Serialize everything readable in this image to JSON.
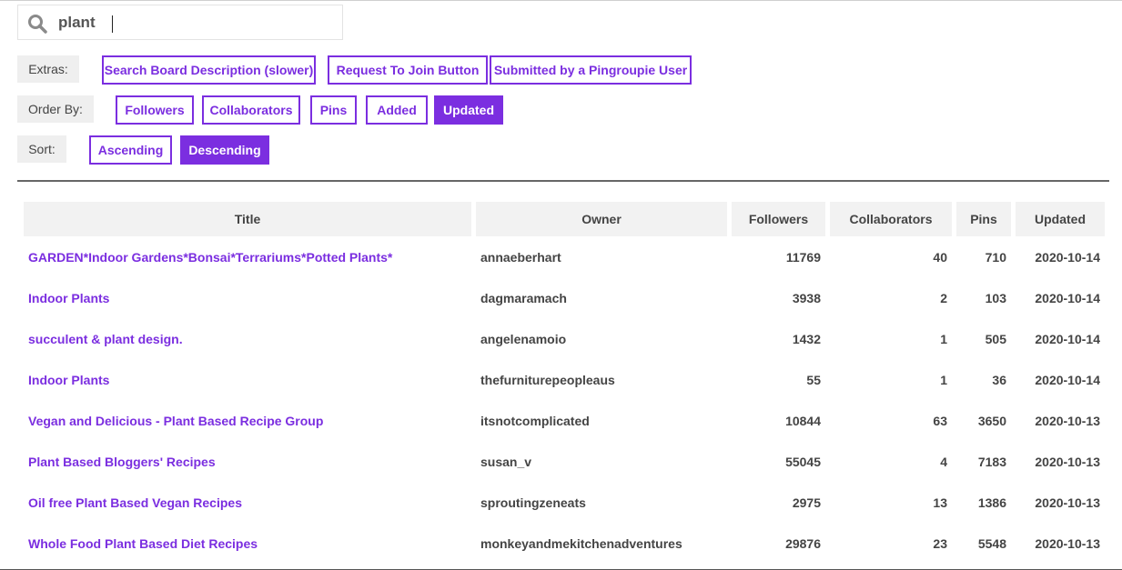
{
  "search": {
    "value": "plant",
    "icon": "search-icon"
  },
  "filters": {
    "extras": {
      "label": "Extras:",
      "options": [
        "Search Board Description (slower)",
        "Request To Join Button",
        "Submitted by a Pingroupie User"
      ]
    },
    "order_by": {
      "label": "Order By:",
      "options": [
        "Followers",
        "Collaborators",
        "Pins",
        "Added",
        "Updated"
      ],
      "selected": "Updated"
    },
    "sort": {
      "label": "Sort:",
      "options": [
        "Ascending",
        "Descending"
      ],
      "selected": "Descending"
    }
  },
  "colors": {
    "accent": "#7b2ee0",
    "header_bg": "#f2f2f2",
    "label_bg": "#efefef"
  },
  "table": {
    "headers": [
      "Title",
      "Owner",
      "Followers",
      "Collaborators",
      "Pins",
      "Updated"
    ],
    "rows": [
      {
        "title": "GARDEN*Indoor Gardens*Bonsai*Terrariums*Potted Plants*",
        "owner": "annaeberhart",
        "followers": "11769",
        "collaborators": "40",
        "pins": "710",
        "updated": "2020-10-14"
      },
      {
        "title": "Indoor Plants",
        "owner": "dagmaramach",
        "followers": "3938",
        "collaborators": "2",
        "pins": "103",
        "updated": "2020-10-14"
      },
      {
        "title": "succulent & plant design.",
        "owner": "angelenamoio",
        "followers": "1432",
        "collaborators": "1",
        "pins": "505",
        "updated": "2020-10-14"
      },
      {
        "title": "Indoor Plants",
        "owner": "thefurniturepeopleaus",
        "followers": "55",
        "collaborators": "1",
        "pins": "36",
        "updated": "2020-10-14"
      },
      {
        "title": "Vegan and Delicious - Plant Based Recipe Group",
        "owner": "itsnotcomplicated",
        "followers": "10844",
        "collaborators": "63",
        "pins": "3650",
        "updated": "2020-10-13"
      },
      {
        "title": "Plant Based Bloggers' Recipes",
        "owner": "susan_v",
        "followers": "55045",
        "collaborators": "4",
        "pins": "7183",
        "updated": "2020-10-13"
      },
      {
        "title": "Oil free Plant Based Vegan Recipes",
        "owner": "sproutingzeneats",
        "followers": "2975",
        "collaborators": "13",
        "pins": "1386",
        "updated": "2020-10-13"
      },
      {
        "title": "Whole Food Plant Based Diet Recipes",
        "owner": "monkeyandmekitchenadventures",
        "followers": "29876",
        "collaborators": "23",
        "pins": "5548",
        "updated": "2020-10-13"
      }
    ]
  }
}
